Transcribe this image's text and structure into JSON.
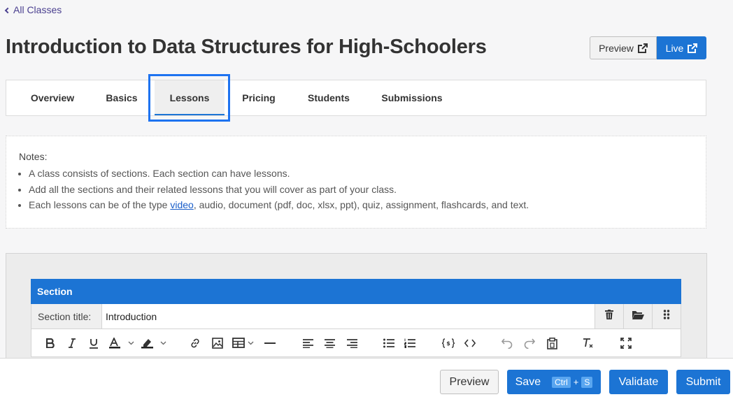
{
  "back_link": "All Classes",
  "page_title": "Introduction to Data Structures for High-Schoolers",
  "header_actions": {
    "preview": "Preview",
    "live": "Live"
  },
  "tabs": [
    {
      "label": "Overview"
    },
    {
      "label": "Basics"
    },
    {
      "label": "Lessons",
      "active": true
    },
    {
      "label": "Pricing"
    },
    {
      "label": "Students"
    },
    {
      "label": "Submissions"
    }
  ],
  "notes": {
    "heading": "Notes:",
    "items": [
      "A class consists of sections. Each section can have lessons.",
      "Add all the sections and their related lessons that you will cover as part of your class."
    ],
    "item3_prefix": "Each lessons can be of the type ",
    "item3_link": "video",
    "item3_suffix": ", audio, document (pdf, doc, xlsx, ppt), quiz, assignment, flashcards, and text."
  },
  "section": {
    "header": "Section",
    "title_label": "Section title:",
    "title_value": "Introduction"
  },
  "toolbar_icons": [
    "bold-icon",
    "italic-icon",
    "underline-icon",
    "font-color-icon",
    "highlight-icon",
    "link-icon",
    "image-icon",
    "table-icon",
    "horizontal-rule-icon",
    "align-left-icon",
    "align-center-icon",
    "align-right-icon",
    "bullet-list-icon",
    "numbered-list-icon",
    "variable-icon",
    "code-icon",
    "undo-icon",
    "redo-icon",
    "paste-icon",
    "clear-format-icon",
    "fullscreen-icon"
  ],
  "footer": {
    "preview": "Preview",
    "save": "Save",
    "save_kbd_ctrl": "Ctrl",
    "save_kbd_plus": "+",
    "save_kbd_s": "S",
    "validate": "Validate",
    "submit": "Submit"
  },
  "colors": {
    "primary": "#1c74d4",
    "highlight": "#1e73f0",
    "link": "#1a5ec9"
  }
}
